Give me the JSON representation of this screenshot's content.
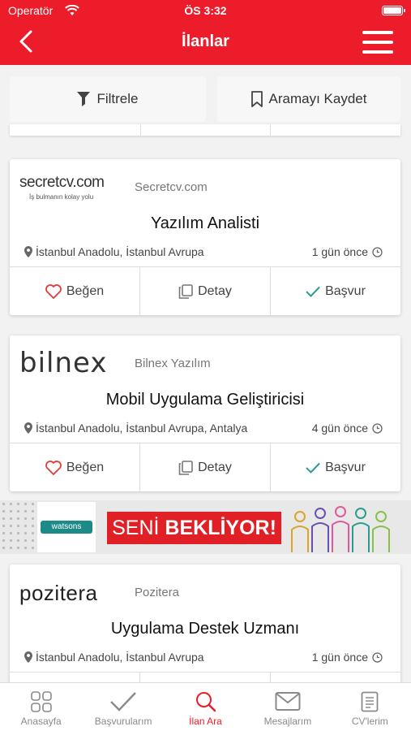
{
  "status": {
    "carrier": "Operatör",
    "time": "ÖS 3:32"
  },
  "nav": {
    "title": "İlanlar"
  },
  "filters": {
    "filter_label": "Filtrele",
    "save_label": "Aramayı Kaydet"
  },
  "jobs": [
    {
      "company": "Secretcv.com",
      "logo_main": "secretcv.com",
      "logo_tagline": "İş bulmanın kolay yolu",
      "title": "Yazılım Analisti",
      "location": "İstanbul Anadolu, İstanbul Avrupa",
      "posted": "1 gün önce"
    },
    {
      "company": "Bilnex Yazılım",
      "logo_main": "bilnex",
      "title": "Mobil Uygulama Geliştiricisi",
      "location": "İstanbul Anadolu, İstanbul Avrupa, Antalya",
      "posted": "4 gün önce"
    },
    {
      "company": "Pozitera",
      "logo_main": "pozitera",
      "title": "Uygulama Destek Uzmanı",
      "location": "İstanbul Anadolu, İstanbul Avrupa",
      "posted": "1 gün önce"
    }
  ],
  "actions": {
    "like": "Beğen",
    "detail": "Detay",
    "apply": "Başvur"
  },
  "banner": {
    "brand": "watsons",
    "text_light": "SENİ",
    "text_bold": "BEKLİYOR!"
  },
  "tabs": [
    {
      "label": "Anasayfa",
      "icon": "grid-icon"
    },
    {
      "label": "Başvurularım",
      "icon": "check-icon"
    },
    {
      "label": "İlan Ara",
      "icon": "search-icon",
      "active": true
    },
    {
      "label": "Mesajlarım",
      "icon": "mail-icon"
    },
    {
      "label": "CV'lerim",
      "icon": "document-icon"
    }
  ],
  "colors": {
    "brand_red": "#ed1c2a",
    "apply_check": "#2a9d8f",
    "like_heart": "#e23b3b"
  }
}
